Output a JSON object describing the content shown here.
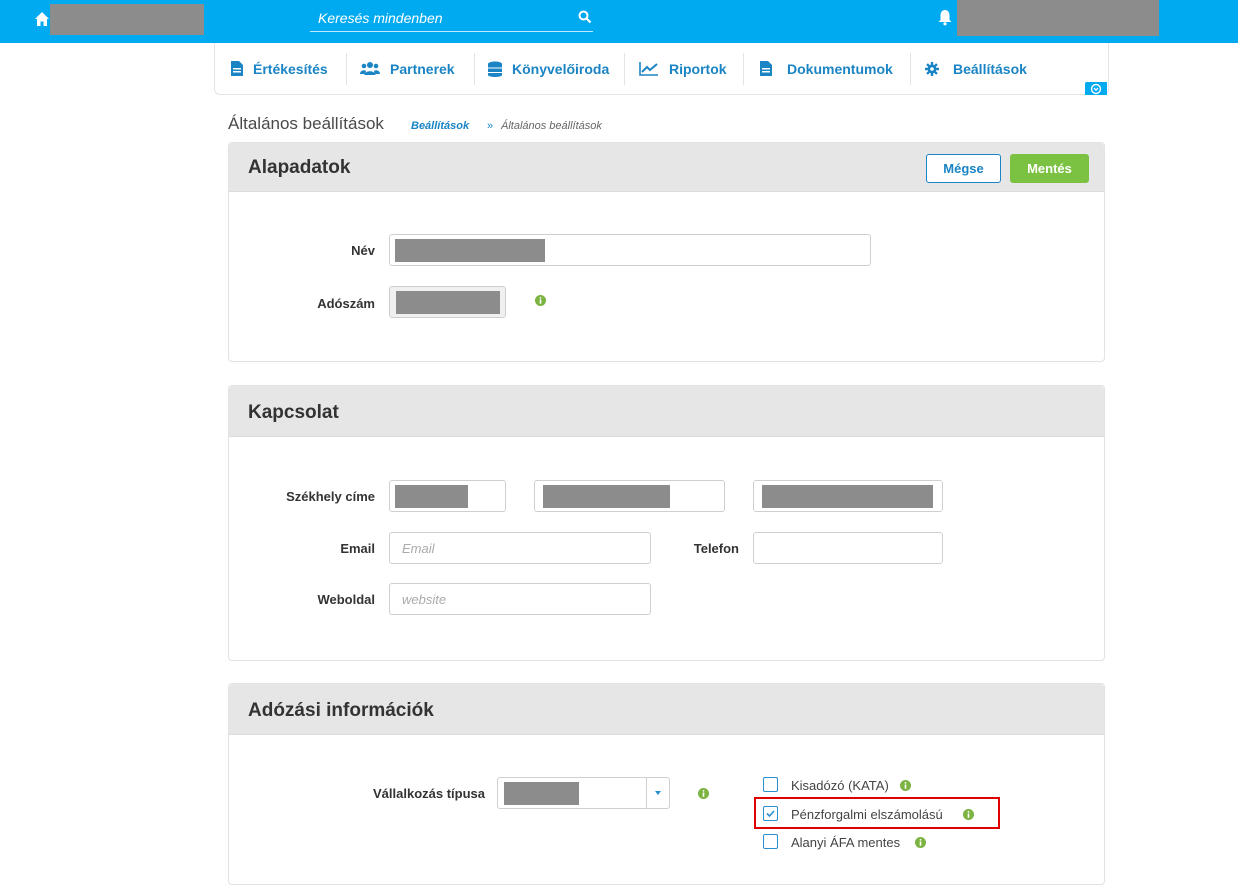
{
  "topbar": {
    "search_placeholder": "Keresés mindenben",
    "icons": [
      "home-icon",
      "search-icon",
      "bell-icon"
    ],
    "color": "#00aaf0"
  },
  "nav": {
    "items": [
      {
        "label": "Értékesítés",
        "icon": "document-icon"
      },
      {
        "label": "Partnerek",
        "icon": "users-icon"
      },
      {
        "label": "Könyvelőiroda",
        "icon": "database-icon"
      },
      {
        "label": "Riportok",
        "icon": "chart-icon"
      },
      {
        "label": "Dokumentumok",
        "icon": "document-icon"
      },
      {
        "label": "Beállítások",
        "icon": "gear-icon"
      }
    ]
  },
  "page": {
    "title": "Általános beállítások",
    "breadcrumb": {
      "link": "Beállítások",
      "sep": "»",
      "current": "Általános beállítások"
    }
  },
  "alapadatok": {
    "title": "Alapadatok",
    "cancel_label": "Mégse",
    "save_label": "Mentés",
    "nev_label": "Név",
    "adoszam_label": "Adószám"
  },
  "kapcsolat": {
    "title": "Kapcsolat",
    "szekhely_label": "Székhely címe",
    "email_label": "Email",
    "email_placeholder": "Email",
    "telefon_label": "Telefon",
    "weboldal_label": "Weboldal",
    "weboldal_placeholder": "website"
  },
  "adozas": {
    "title": "Adózási információk",
    "tipus_label": "Vállalkozás típusa",
    "options": [
      {
        "label": "Kisadózó (KATA)",
        "checked": false
      },
      {
        "label": "Pénzforgalmi elszámolású",
        "checked": true
      },
      {
        "label": "Alanyi ÁFA mentes",
        "checked": false
      }
    ]
  },
  "colors": {
    "accent": "#1a84c4",
    "save": "#7cc242",
    "info": "#7cb342",
    "highlight": "#e00000"
  }
}
